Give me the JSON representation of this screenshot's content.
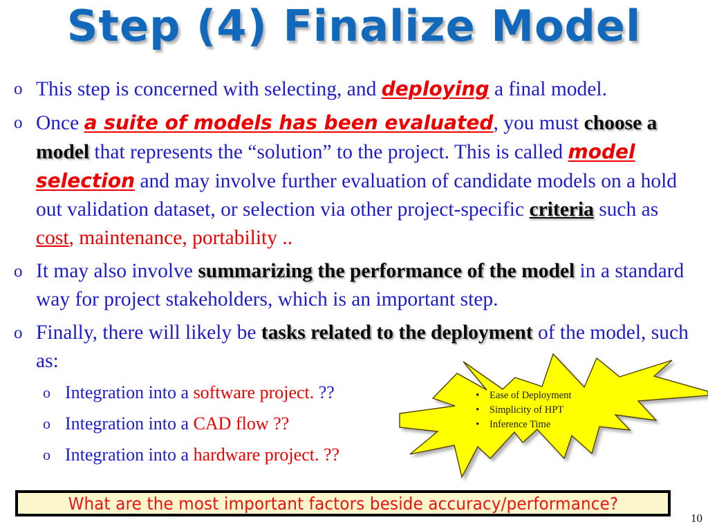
{
  "slide": {
    "title": "Step (4) Finalize Model",
    "page_number": "10",
    "colors": {
      "title_blue": "#1269bb",
      "body_blue": "#1c1ccc",
      "accent_red": "#ee0000",
      "emphasis_black": "#0a0a0a",
      "callout_yellow": "#ffff00",
      "banner_fill": "#fcf6cd",
      "banner_border": "#000000",
      "banner_text_red": "#e81414"
    }
  },
  "bullets": {
    "marker": "o",
    "items": [
      {
        "id": "bullet-1",
        "runs": [
          {
            "text": "This step is concerned with selecting, and ",
            "style": "blue"
          },
          {
            "text": "deploying",
            "style": "red-italic-underline"
          },
          {
            "text": " a final model.",
            "style": "blue"
          }
        ]
      },
      {
        "id": "bullet-2",
        "runs": [
          {
            "text": "Once ",
            "style": "blue"
          },
          {
            "text": "a suite of models has been evaluated",
            "style": "red-italic-underline"
          },
          {
            "text": ", you must ",
            "style": "blue"
          },
          {
            "text": "choose a model",
            "style": "black-bold"
          },
          {
            "text": " that represents the “solution” to the project. This is called ",
            "style": "blue"
          },
          {
            "text": "model selection",
            "style": "red-italic-underline"
          },
          {
            "text": " and may involve further evaluation of candidate models on a hold out validation dataset, or selection via other project-specific ",
            "style": "blue"
          },
          {
            "text": "criteria",
            "style": "black-bold-underline"
          },
          {
            "text": " such as ",
            "style": "blue"
          },
          {
            "text": "cost",
            "style": "red-underline"
          },
          {
            "text": ", maintenance, portability ..",
            "style": "red"
          }
        ]
      },
      {
        "id": "bullet-3",
        "runs": [
          {
            "text": "It may also involve ",
            "style": "blue"
          },
          {
            "text": "summarizing the performance of the model",
            "style": "black-bold"
          },
          {
            "text": " in a standard way for project stakeholders, which is an important step.",
            "style": "blue"
          }
        ]
      },
      {
        "id": "bullet-4",
        "runs": [
          {
            "text": "Finally, there will likely be ",
            "style": "blue"
          },
          {
            "text": "tasks related to the deployment",
            "style": "black-bold"
          },
          {
            "text": " of the model, such as:",
            "style": "blue"
          }
        ],
        "sub_marker": "o",
        "sub_items": [
          {
            "id": "sub-bullet-1",
            "runs": [
              {
                "text": "Integration into a ",
                "style": "blue"
              },
              {
                "text": "software project.",
                "style": "red"
              },
              {
                "text": " ??",
                "style": "blue"
              }
            ]
          },
          {
            "id": "sub-bullet-2",
            "runs": [
              {
                "text": "Integration into a ",
                "style": "blue"
              },
              {
                "text": "CAD flow ??",
                "style": "red"
              }
            ]
          },
          {
            "id": "sub-bullet-3",
            "runs": [
              {
                "text": "Integration into a ",
                "style": "blue"
              },
              {
                "text": "hardware project. ??",
                "style": "red"
              }
            ]
          }
        ]
      }
    ]
  },
  "callout": {
    "shape": "explosion-starburst",
    "bullet_char": "•",
    "items": [
      "Ease of Deployment",
      "Simplicity of HPT",
      "Inference Time"
    ]
  },
  "banner": {
    "text": "What are the most important factors beside accuracy/performance?"
  }
}
